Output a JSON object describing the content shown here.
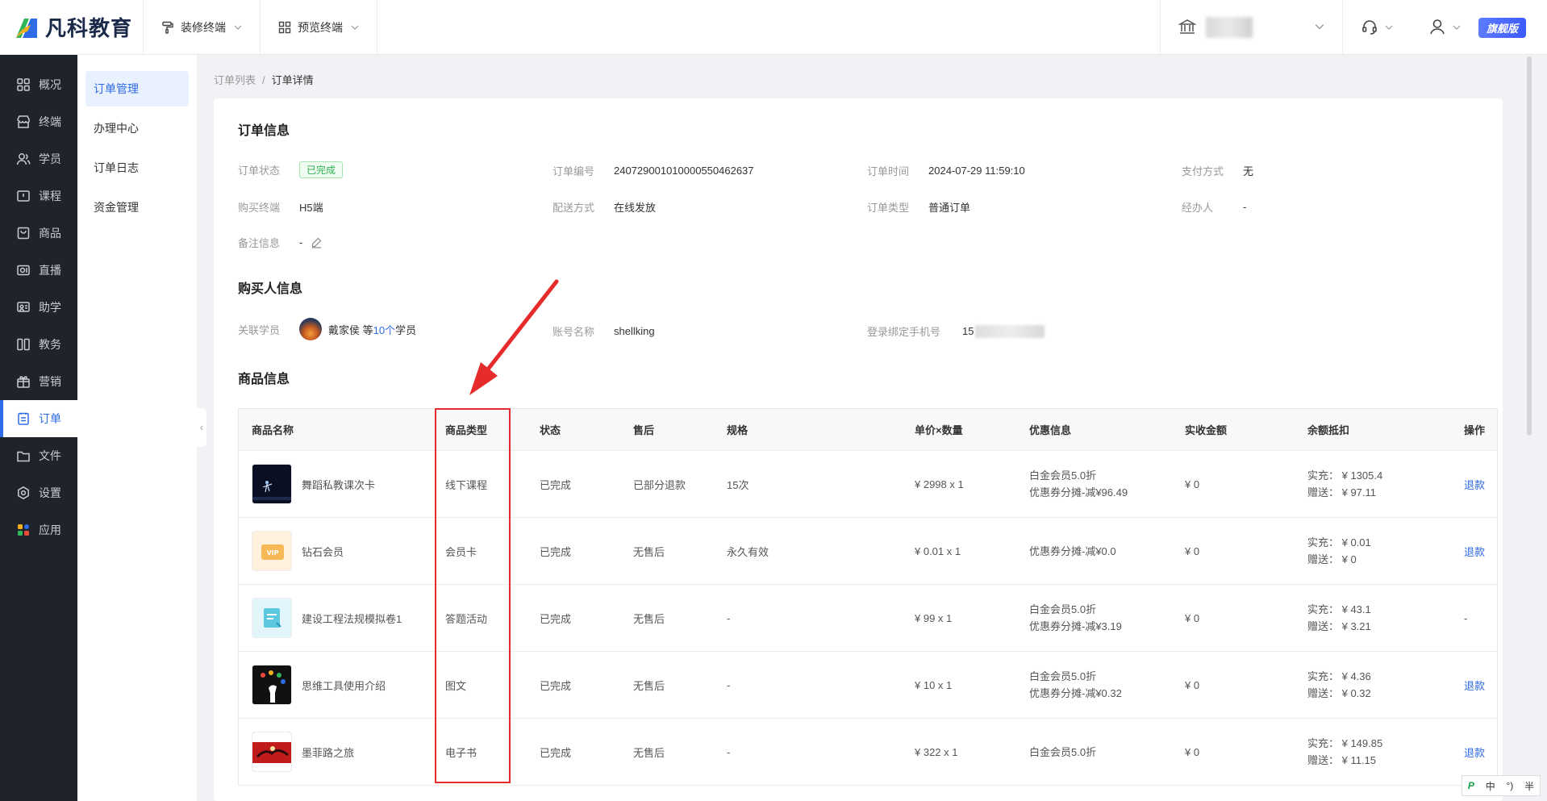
{
  "brand": {
    "name": "凡科教育"
  },
  "topbar": {
    "menus": [
      {
        "label": "装修终端",
        "icon": "paint-roller-icon"
      },
      {
        "label": "预览终端",
        "icon": "grid-icon"
      }
    ],
    "plan_badge": "旗舰版"
  },
  "leftnav": {
    "items": [
      {
        "label": "概况",
        "icon": "grid-icon"
      },
      {
        "label": "终端",
        "icon": "store-icon"
      },
      {
        "label": "学员",
        "icon": "users-icon"
      },
      {
        "label": "课程",
        "icon": "book-icon"
      },
      {
        "label": "商品",
        "icon": "bag-icon"
      },
      {
        "label": "直播",
        "icon": "live-icon"
      },
      {
        "label": "助学",
        "icon": "help-study-icon"
      },
      {
        "label": "教务",
        "icon": "columns-icon"
      },
      {
        "label": "营销",
        "icon": "gift-icon"
      },
      {
        "label": "订单",
        "icon": "order-icon",
        "active": true
      },
      {
        "label": "文件",
        "icon": "folder-icon"
      },
      {
        "label": "设置",
        "icon": "gear-icon"
      },
      {
        "label": "应用",
        "icon": "apps-icon"
      }
    ]
  },
  "subnav": {
    "items": [
      {
        "label": "订单管理",
        "active": true
      },
      {
        "label": "办理中心"
      },
      {
        "label": "订单日志"
      },
      {
        "label": "资金管理"
      }
    ]
  },
  "breadcrumb": {
    "parent": "订单列表",
    "separator": "/",
    "current": "订单详情"
  },
  "order_info": {
    "title": "订单信息",
    "status_label": "订单状态",
    "status_value": "已完成",
    "order_no_label": "订单编号",
    "order_no_value": "2407290010100005504626​37",
    "order_time_label": "订单时间",
    "order_time_value": "2024-07-29 11:59:10",
    "pay_label": "支付方式",
    "pay_value": "无",
    "terminal_label": "购买终端",
    "terminal_value": "H5端",
    "delivery_label": "配送方式",
    "delivery_value": "在线发放",
    "type_label": "订单类型",
    "type_value": "普通订单",
    "handler_label": "经办人",
    "handler_value": "-",
    "remark_label": "备注信息",
    "remark_value": "-"
  },
  "buyer_info": {
    "title": "购买人信息",
    "student_label": "关联学员",
    "student_name": "戴家侯 等",
    "student_count": "10个",
    "student_suffix": "学员",
    "account_label": "账号名称",
    "account_value": "shellking",
    "phone_label": "登录绑定手机号",
    "phone_prefix": "15"
  },
  "goods_info": {
    "title": "商品信息",
    "columns": [
      "商品名称",
      "商品类型",
      "状态",
      "售后",
      "规格",
      "单价×数量",
      "优惠信息",
      "实收金额",
      "余额抵扣",
      "操作"
    ],
    "rows": [
      {
        "name": "舞蹈私教课次卡",
        "type": "线下课程",
        "status": "已完成",
        "after_sale": "已部分退款",
        "spec": "15次",
        "price_qty": "¥ 2998 x 1",
        "discount": [
          "白金会员5.0折",
          "优惠券分摊-减¥96.49"
        ],
        "paid": "¥ 0",
        "balance": [
          "实充： ¥ 1305.4",
          "赠送： ¥ 97.11"
        ],
        "action": "退款",
        "action_link": true,
        "thumb": "dance"
      },
      {
        "name": "钻石会员",
        "type": "会员卡",
        "status": "已完成",
        "after_sale": "无售后",
        "spec": "永久有效",
        "price_qty": "¥ 0.01 x 1",
        "discount": [
          "优惠券分摊-减¥0.0"
        ],
        "paid": "¥ 0",
        "balance": [
          "实充： ¥ 0.01",
          "赠送： ¥ 0"
        ],
        "action": "退款",
        "action_link": true,
        "thumb": "vip"
      },
      {
        "name": "建设工程法规模拟卷1",
        "type": "答题活动",
        "status": "已完成",
        "after_sale": "无售后",
        "spec": "-",
        "price_qty": "¥ 99 x 1",
        "discount": [
          "白金会员5.0折",
          "优惠券分摊-减¥3.19"
        ],
        "paid": "¥ 0",
        "balance": [
          "实充： ¥ 43.1",
          "赠送： ¥ 3.21"
        ],
        "action": "-",
        "action_link": false,
        "thumb": "quiz"
      },
      {
        "name": "思维工具使用介绍",
        "type": "图文",
        "status": "已完成",
        "after_sale": "无售后",
        "spec": "-",
        "price_qty": "¥ 10 x 1",
        "discount": [
          "白金会员5.0折",
          "优惠券分摊-减¥0.32"
        ],
        "paid": "¥ 0",
        "balance": [
          "实充： ¥ 4.36",
          "赠送： ¥ 0.32"
        ],
        "action": "退款",
        "action_link": true,
        "thumb": "mind"
      },
      {
        "name": "墨菲路之旅",
        "type": "电子书",
        "status": "已完成",
        "after_sale": "无售后",
        "spec": "-",
        "price_qty": "¥ 322 x 1",
        "discount": [
          "白金会员5.0折"
        ],
        "paid": "¥ 0",
        "balance": [
          "实充： ¥ 149.85",
          "赠送： ¥ 11.15"
        ],
        "action": "退款",
        "action_link": true,
        "thumb": "book"
      }
    ]
  },
  "ime": {
    "items": [
      "中",
      "°)",
      "半"
    ]
  },
  "colors": {
    "primary": "#2e6be6",
    "sidebar": "#1f232a",
    "success": "#2db351",
    "annotation": "#e52b2b"
  }
}
